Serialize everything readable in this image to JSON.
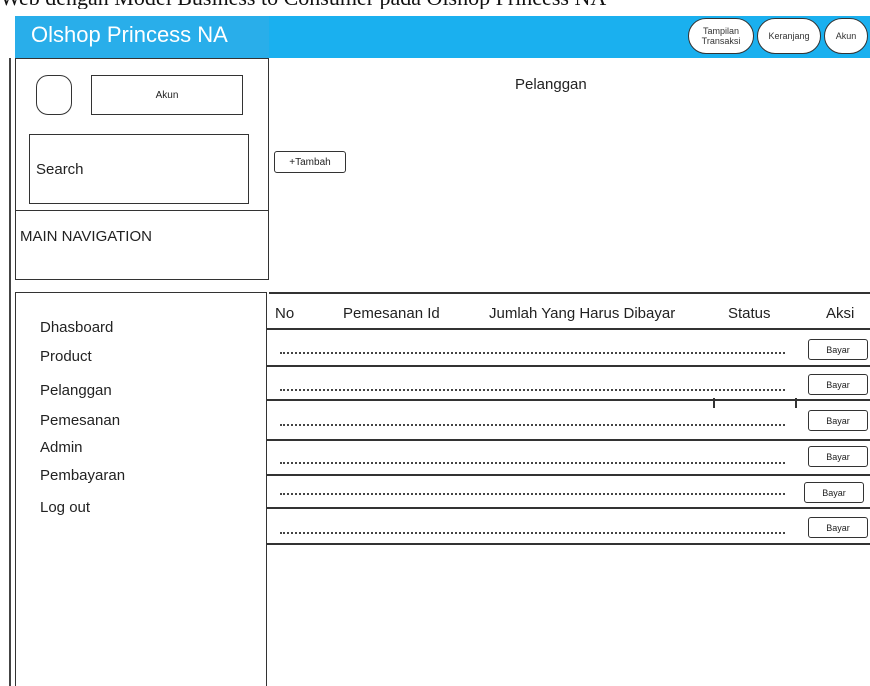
{
  "caption": "Web dengan Model Business to Consumer pada Olshop Princess NA",
  "header": {
    "brand": "Olshop Princess NA",
    "buttons": [
      "Tampilan Transaksi",
      "Keranjang",
      "Akun"
    ]
  },
  "sidebar": {
    "account_label": "Akun",
    "search_label": "Search",
    "nav_heading": "MAIN NAVIGATION",
    "menu": [
      "Dhasboard",
      "Product",
      "Pelanggan",
      "Pemesanan",
      "Admin",
      "Pembayaran",
      "Log out"
    ]
  },
  "main": {
    "title": "Pelanggan",
    "add_button": "+Tambah",
    "columns": [
      "No",
      "Pemesanan Id",
      "Jumlah Yang Harus Dibayar",
      "Status",
      "Aksi"
    ],
    "row_action": "Bayar"
  },
  "colors": {
    "header_bg": "#1ab0ef",
    "brand_bg": "#29aeea"
  }
}
